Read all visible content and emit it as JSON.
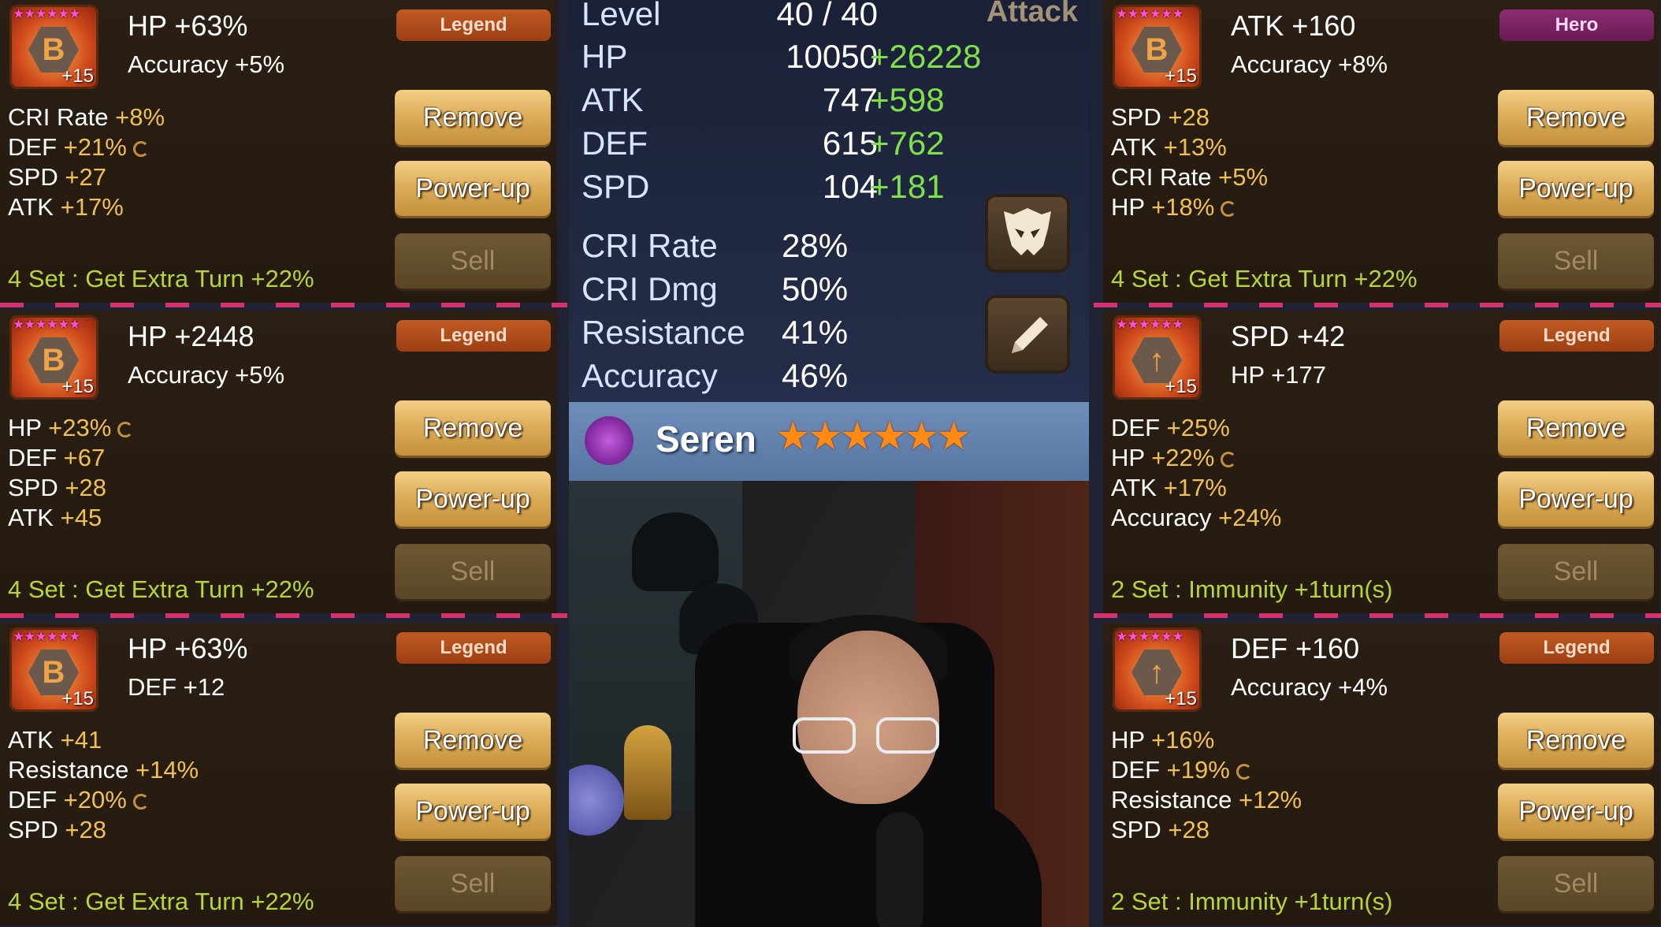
{
  "left_runes": [
    {
      "stars": "★★★★★★",
      "level": "+15",
      "glyph": "B",
      "main_stat": "HP +63%",
      "innate_stat": "Accuracy +5%",
      "grade": "Legend",
      "grade_type": "legend",
      "substats": [
        {
          "name": "CRI Rate",
          "value": "+8%",
          "grinded": false
        },
        {
          "name": "DEF",
          "value": "+21%",
          "grinded": true
        },
        {
          "name": "SPD",
          "value": "+27",
          "grinded": false
        },
        {
          "name": "ATK",
          "value": "+17%",
          "grinded": false
        }
      ],
      "set_effect": "4 Set : Get Extra Turn +22%",
      "buttons": {
        "remove": "Remove",
        "power": "Power-up",
        "sell": "Sell"
      }
    },
    {
      "stars": "★★★★★★",
      "level": "+15",
      "glyph": "B",
      "main_stat": "HP +2448",
      "innate_stat": "Accuracy +5%",
      "grade": "Legend",
      "grade_type": "legend",
      "substats": [
        {
          "name": "HP",
          "value": "+23%",
          "grinded": true
        },
        {
          "name": "DEF",
          "value": "+67",
          "grinded": false
        },
        {
          "name": "SPD",
          "value": "+28",
          "grinded": false
        },
        {
          "name": "ATK",
          "value": "+45",
          "grinded": false
        }
      ],
      "set_effect": "4 Set : Get Extra Turn +22%",
      "buttons": {
        "remove": "Remove",
        "power": "Power-up",
        "sell": "Sell"
      }
    },
    {
      "stars": "★★★★★★",
      "level": "+15",
      "glyph": "B",
      "main_stat": "HP +63%",
      "innate_stat": "DEF +12",
      "grade": "Legend",
      "grade_type": "legend",
      "substats": [
        {
          "name": "ATK",
          "value": "+41",
          "grinded": false
        },
        {
          "name": "Resistance",
          "value": "+14%",
          "grinded": false
        },
        {
          "name": "DEF",
          "value": "+20%",
          "grinded": true
        },
        {
          "name": "SPD",
          "value": "+28",
          "grinded": false
        }
      ],
      "set_effect": "4 Set : Get Extra Turn +22%",
      "buttons": {
        "remove": "Remove",
        "power": "Power-up",
        "sell": "Sell"
      }
    }
  ],
  "right_runes": [
    {
      "stars": "★★★★★★",
      "level": "+15",
      "glyph": "B",
      "main_stat": "ATK +160",
      "innate_stat": "Accuracy +8%",
      "grade": "Hero",
      "grade_type": "hero",
      "substats": [
        {
          "name": "SPD",
          "value": "+28",
          "grinded": false
        },
        {
          "name": "ATK",
          "value": "+13%",
          "grinded": false
        },
        {
          "name": "CRI Rate",
          "value": "+5%",
          "grinded": false
        },
        {
          "name": "HP",
          "value": "+18%",
          "grinded": true
        }
      ],
      "set_effect": "4 Set : Get Extra Turn +22%",
      "buttons": {
        "remove": "Remove",
        "power": "Power-up",
        "sell": "Sell"
      }
    },
    {
      "stars": "★★★★★★",
      "level": "+15",
      "glyph": "↑",
      "main_stat": "SPD +42",
      "innate_stat": "HP +177",
      "grade": "Legend",
      "grade_type": "legend",
      "substats": [
        {
          "name": "DEF",
          "value": "+25%",
          "grinded": false
        },
        {
          "name": "HP",
          "value": "+22%",
          "grinded": true
        },
        {
          "name": "ATK",
          "value": "+17%",
          "grinded": false
        },
        {
          "name": "Accuracy",
          "value": "+24%",
          "grinded": false
        }
      ],
      "set_effect": "2 Set : Immunity +1turn(s)",
      "buttons": {
        "remove": "Remove",
        "power": "Power-up",
        "sell": "Sell"
      }
    },
    {
      "stars": "★★★★★★",
      "level": "+15",
      "glyph": "↑",
      "main_stat": "DEF +160",
      "innate_stat": "Accuracy +4%",
      "grade": "Legend",
      "grade_type": "legend",
      "substats": [
        {
          "name": "HP",
          "value": "+16%",
          "grinded": false
        },
        {
          "name": "DEF",
          "value": "+19%",
          "grinded": true
        },
        {
          "name": "Resistance",
          "value": "+12%",
          "grinded": false
        },
        {
          "name": "SPD",
          "value": "+28",
          "grinded": false
        }
      ],
      "set_effect": "2 Set : Immunity +1turn(s)",
      "buttons": {
        "remove": "Remove",
        "power": "Power-up",
        "sell": "Sell"
      }
    }
  ],
  "monster": {
    "attribute_label": "Attack",
    "level": {
      "label": "Level",
      "value": "40 / 40"
    },
    "stats": [
      {
        "label": "HP",
        "base": "10050",
        "bonus": "+26228"
      },
      {
        "label": "ATK",
        "base": "747",
        "bonus": "+598"
      },
      {
        "label": "DEF",
        "base": "615",
        "bonus": "+762"
      },
      {
        "label": "SPD",
        "base": "104",
        "bonus": "+181"
      }
    ],
    "secondary_stats": [
      {
        "label": "CRI Rate",
        "value": "28%"
      },
      {
        "label": "CRI Dmg",
        "value": "50%"
      },
      {
        "label": "Resistance",
        "value": "41%"
      },
      {
        "label": "Accuracy",
        "value": "46%"
      }
    ],
    "name": "Seren",
    "stars": "★★★★★★",
    "element_color": "#a63fc4",
    "icons": [
      "skull-mask-icon",
      "pencil-icon"
    ]
  },
  "colors": {
    "bonus_green": "#7ee04b",
    "set_effect": "#b7d438",
    "legend_badge": "#b34d1c",
    "hero_badge": "#7d2466"
  }
}
